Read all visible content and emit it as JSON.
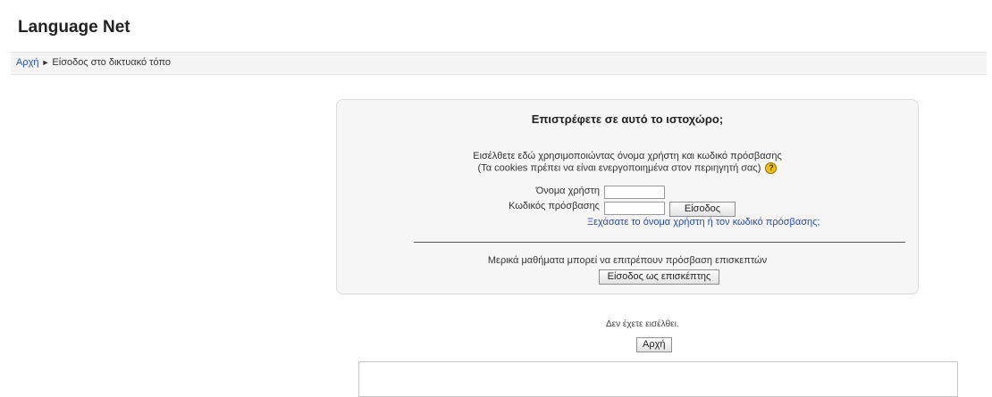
{
  "header": {
    "site_title": "Language Net"
  },
  "breadcrumb": {
    "home": "Αρχή",
    "separator": "►",
    "current": "Είσοδος στο δικτυακό τόπο"
  },
  "login": {
    "heading": "Επιστρέφετε σε αυτό το ιστοχώρο;",
    "intro_line1": "Εισέλθετε εδώ χρησιμοποιώντας όνομα χρήστη και κωδικό πρόσβασης",
    "intro_line2": "(Τα cookies πρέπει να είναι ενεργοποιημένα στον περιηγητή σας)",
    "help_glyph": "?",
    "username_label": "Όνομα χρήστη",
    "username_value": "",
    "password_label": "Κωδικός πρόσβασης",
    "password_value": "",
    "login_button": "Είσοδος",
    "forgot_link": "Ξεχάσατε το όνομα χρήστη ή τον κωδικό πρόσβασης;",
    "guest_text": "Μερικά μαθήματα μπορεί να επιτρέπουν πρόσβαση επισκεπτών",
    "guest_button": "Είσοδος ως επισκέπτης"
  },
  "footer": {
    "not_logged_in": "Δεν έχετε εισέλθει.",
    "home_button": "Αρχή"
  },
  "colors": {
    "link": "#2a4ea8",
    "help_icon": "#f2c200",
    "box_bg": "#f6f6f6"
  }
}
